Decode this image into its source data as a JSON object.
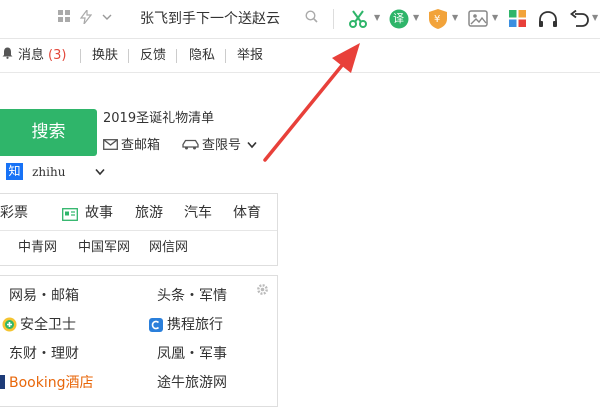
{
  "toolbar": {
    "search_text": "张飞到手下一个送赵云",
    "icons": [
      "grid-icon",
      "lightning-icon",
      "chevron-down-icon",
      "search-icon",
      "scissors-icon",
      "translate-icon",
      "shield-icon",
      "image-icon",
      "apps-icon",
      "headphones-icon",
      "undo-icon"
    ],
    "translate_badge": "译",
    "shield_badge": "¥"
  },
  "bar2": {
    "message_label": "消息",
    "message_count": "(3)",
    "skin": "换肤",
    "feedback": "反馈",
    "privacy": "隐私",
    "report": "举报"
  },
  "search": {
    "button": "搜索",
    "promo": "2019圣诞礼物清单",
    "mail": "查邮箱",
    "plate": "查限号",
    "engine_badge": "知",
    "engine": "zhihu"
  },
  "categories": [
    "彩票",
    "故事",
    "旅游",
    "汽车",
    "体育"
  ],
  "sub_links": [
    "中青网",
    "中国军网",
    "网信网"
  ],
  "sites": {
    "left": [
      "网易・邮箱",
      "安全卫士",
      "东财・理财",
      "Booking酒店"
    ],
    "right": [
      "头条・军情",
      "携程旅行",
      "凤凰・军事",
      "途牛旅游网"
    ]
  },
  "colors": {
    "accent_green": "#2fb56a",
    "arrow_red": "#e8403a",
    "booking_orange": "#e8670b"
  }
}
